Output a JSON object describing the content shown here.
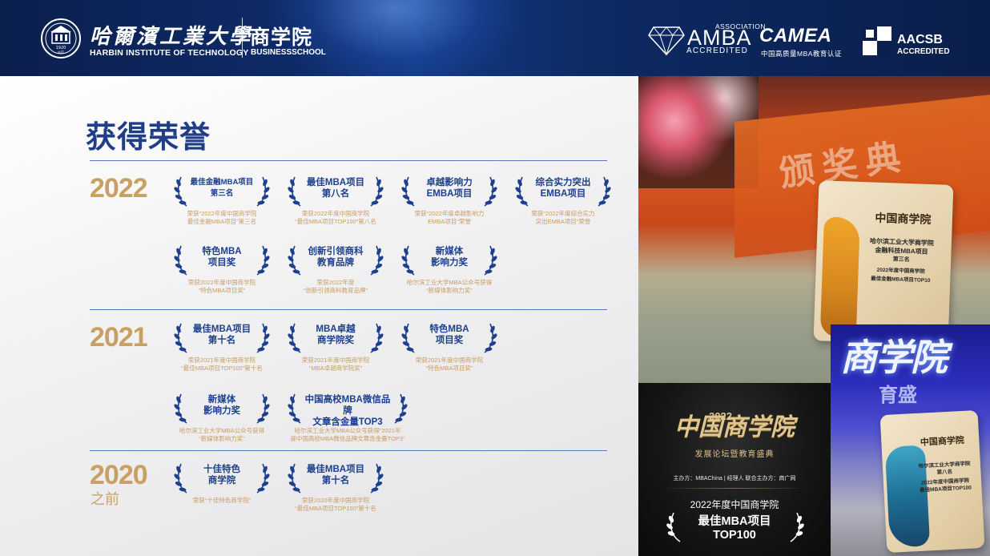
{
  "header": {
    "university_cn": "哈爾濱工業大學",
    "university_en": "HARBIN INSTITUTE OF TECHNOLOGY",
    "school_cn": "商学院",
    "school_en": "BUSINESSSCHOOL",
    "emblem_year": "1920",
    "emblem_text": "HIT",
    "amba_assoc": "ASSOCIATION",
    "amba_name": "AMBA",
    "amba_accredited": "ACCREDITED",
    "camea_name": "CAMEA",
    "camea_sub": "中国高质量MBA教育认证",
    "aacsb_name": "AACSB",
    "aacsb_accredited": "ACCREDITED",
    "brand_color": "#0e2b68"
  },
  "title": "获得荣誉",
  "years": [
    {
      "label": "2022",
      "sub": ""
    },
    {
      "label": "2021",
      "sub": ""
    },
    {
      "label": "2020",
      "sub": "之前"
    }
  ],
  "awards": [
    {
      "line1": "最佳金融MBA项目",
      "line2": "第三名",
      "desc1": "荣获“2022年度中国商学院",
      "desc2": "最佳金融MBA项目”第三名"
    },
    {
      "line1": "最佳MBA项目",
      "line2": "第八名",
      "desc1": "荣获2022年度中国商学院",
      "desc2": "“最佳MBA项目TOP100”第八名"
    },
    {
      "line1": "卓越影响力",
      "line2": "EMBA项目",
      "desc1": "荣获“2022年度卓越影响力",
      "desc2": "EMBA项目”荣誉"
    },
    {
      "line1": "综合实力突出",
      "line2": "EMBA项目",
      "desc1": "荣获“2022年度综合实力",
      "desc2": "突出EMBA项目”荣誉"
    },
    {
      "line1": "特色MBA",
      "line2": "项目奖",
      "desc1": "荣获2022年度中国商学院",
      "desc2": "“特色MBA项目奖”"
    },
    {
      "line1": "创新引领商科",
      "line2": "教育品牌",
      "desc1": "荣获2022年度",
      "desc2": "“创新引领商科教育品牌”"
    },
    {
      "line1": "新媒体",
      "line2": "影响力奖",
      "desc1": "哈尔滨工业大学MBA公众号获得",
      "desc2": "“新媒体影响力奖”"
    },
    {
      "line1": "最佳MBA项目",
      "line2": "第十名",
      "desc1": "荣获2021年度中国商学院",
      "desc2": "“最佳MBA项目TOP100”第十名"
    },
    {
      "line1": "MBA卓越",
      "line2": "商学院奖",
      "desc1": "荣获2021年度中国商学院",
      "desc2": "“MBA卓越商学院奖”"
    },
    {
      "line1": "特色MBA",
      "line2": "项目奖",
      "desc1": "荣获2021年度中国商学院",
      "desc2": "“特色MBA项目奖”"
    },
    {
      "line1": "新媒体",
      "line2": "影响力奖",
      "desc1": "哈尔滨工业大学MBA公众号获得",
      "desc2": "“新媒体影响力奖”"
    },
    {
      "line1": "中国高校MBA微信品牌",
      "line2": "文章含金量TOP3",
      "desc1": "哈尔滨工业大学MBA公众号获得“2021年",
      "desc2": "度中国高校MBA微信品牌文章含金量TOP3”"
    },
    {
      "line1": "十佳特色",
      "line2": "商学院",
      "desc1": "荣获“十佳特色商学院”",
      "desc2": ""
    },
    {
      "line1": "最佳MBA项目",
      "line2": "第十名",
      "desc1": "荣获2020年度中国商学院",
      "desc2": "“最佳MBA项目TOP100”第十名"
    }
  ],
  "photos": {
    "banner_text": "颁奖典",
    "plaque1": {
      "title": "中国商学院",
      "l1": "哈尔滨工业大学商学院",
      "l2": "金融科技MBA项目",
      "l3": "第三名",
      "l4": "2022年度中国商学院",
      "l5": "最佳金融MBA项目TOP10"
    },
    "gala": {
      "year": "2022",
      "title": "中国商学院",
      "sub": "发展论坛暨教育盛典",
      "sponsors": "主办方：MBAChina | 经理人  联合主办方：商广网",
      "a1": "2022年度中国商学院",
      "a2": "最佳MBA项目",
      "a3": "TOP100"
    },
    "neon_text": "商学院",
    "neon_text2": "育盛",
    "plaque2": {
      "title": "中国商学院",
      "l1": "哈尔滨工业大学商学院",
      "l2": "第八名",
      "l3": "2022年度中国商学院",
      "l4": "最佳MBA项目TOP100"
    }
  }
}
